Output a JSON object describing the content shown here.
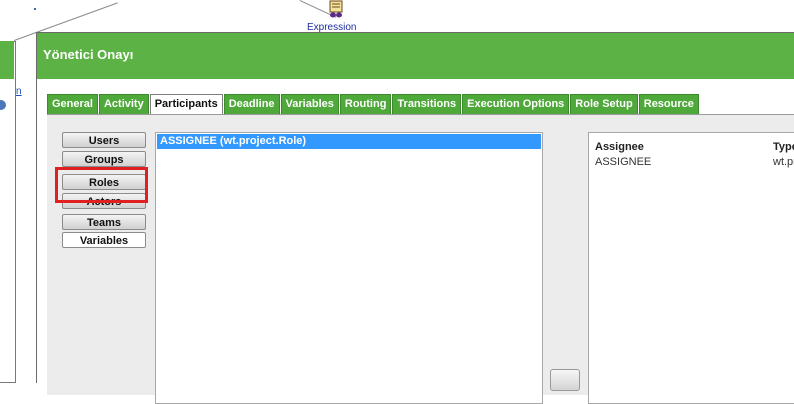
{
  "canvas": {
    "expression_label": "Expression",
    "left_link": "n"
  },
  "dialog": {
    "title": "Yönetici Onayı",
    "tabs": [
      {
        "label": "General",
        "active": false
      },
      {
        "label": "Activity",
        "active": false
      },
      {
        "label": "Participants",
        "active": true
      },
      {
        "label": "Deadline",
        "active": false
      },
      {
        "label": "Variables",
        "active": false
      },
      {
        "label": "Routing",
        "active": false
      },
      {
        "label": "Transitions",
        "active": false
      },
      {
        "label": "Execution Options",
        "active": false
      },
      {
        "label": "Role Setup",
        "active": false
      },
      {
        "label": "Resource",
        "active": false
      }
    ],
    "participant_types": [
      "Users",
      "Groups",
      "Roles",
      "Actors",
      "Teams",
      "Variables"
    ],
    "selected_participant_type": "Variables",
    "available_list": [
      "ASSIGNEE (wt.project.Role)"
    ],
    "selected_table": {
      "columns": [
        "Assignee",
        "Type"
      ],
      "rows": [
        [
          "ASSIGNEE",
          "wt.pr"
        ]
      ]
    }
  },
  "colors": {
    "title_green": "#5cb244",
    "tab_green": "#4ea93a",
    "selection_blue": "#3399ff",
    "highlight_red": "#e02020"
  }
}
